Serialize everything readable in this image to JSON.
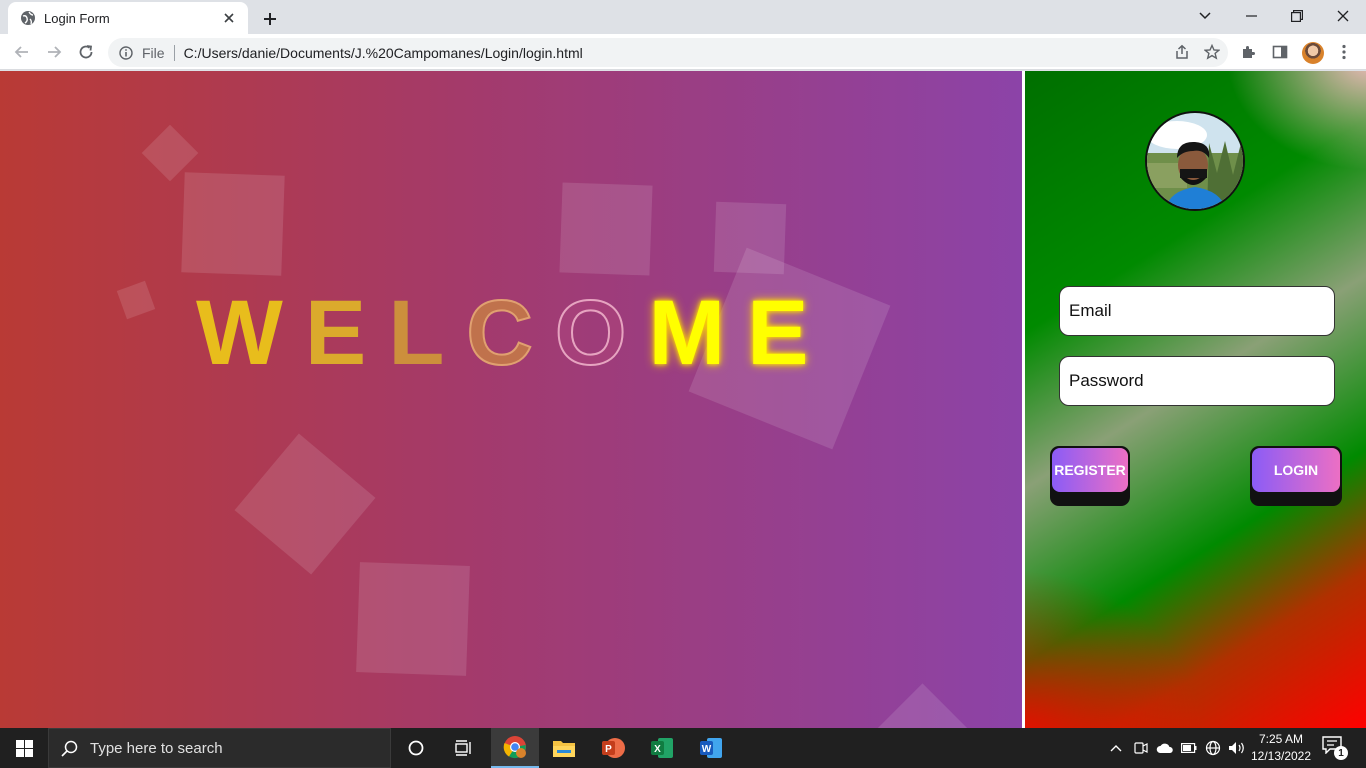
{
  "browser": {
    "tab_title": "Login Form",
    "address_scheme_label": "File",
    "address_url": "C:/Users/danie/Documents/J.%20Campomanes/Login/login.html",
    "icons": [
      "globe-icon",
      "close-icon",
      "plus-icon",
      "chevron-down-icon",
      "minimize-icon",
      "restore-icon",
      "window-close-icon",
      "back-icon",
      "forward-icon",
      "reload-icon",
      "info-icon",
      "share-icon",
      "star-icon",
      "extensions-icon",
      "side-panel-icon",
      "kebab-menu-icon"
    ]
  },
  "page": {
    "welcome_letters": [
      "W",
      "E",
      "L",
      "C",
      "O",
      "M",
      "E"
    ],
    "email_placeholder": "Email",
    "password_placeholder": "Password",
    "register_label": "REGISTER",
    "login_label": "LOGIN",
    "colors": {
      "gradient_left": "#b93a35",
      "gradient_right": "#8c43a8",
      "login_bg_green": "#008a00",
      "login_bg_red": "#ff0000",
      "button_gradient_start": "#8b5cf6",
      "button_gradient_end": "#ec6fc4",
      "letter_gold": "#e3b520",
      "letter_yellow": "#ffff00"
    }
  },
  "taskbar": {
    "search_placeholder": "Type here to search",
    "time": "7:25 AM",
    "date": "12/13/2022",
    "notification_count": "1",
    "apps": [
      "chrome",
      "file-explorer",
      "powerpoint",
      "excel",
      "word"
    ]
  }
}
